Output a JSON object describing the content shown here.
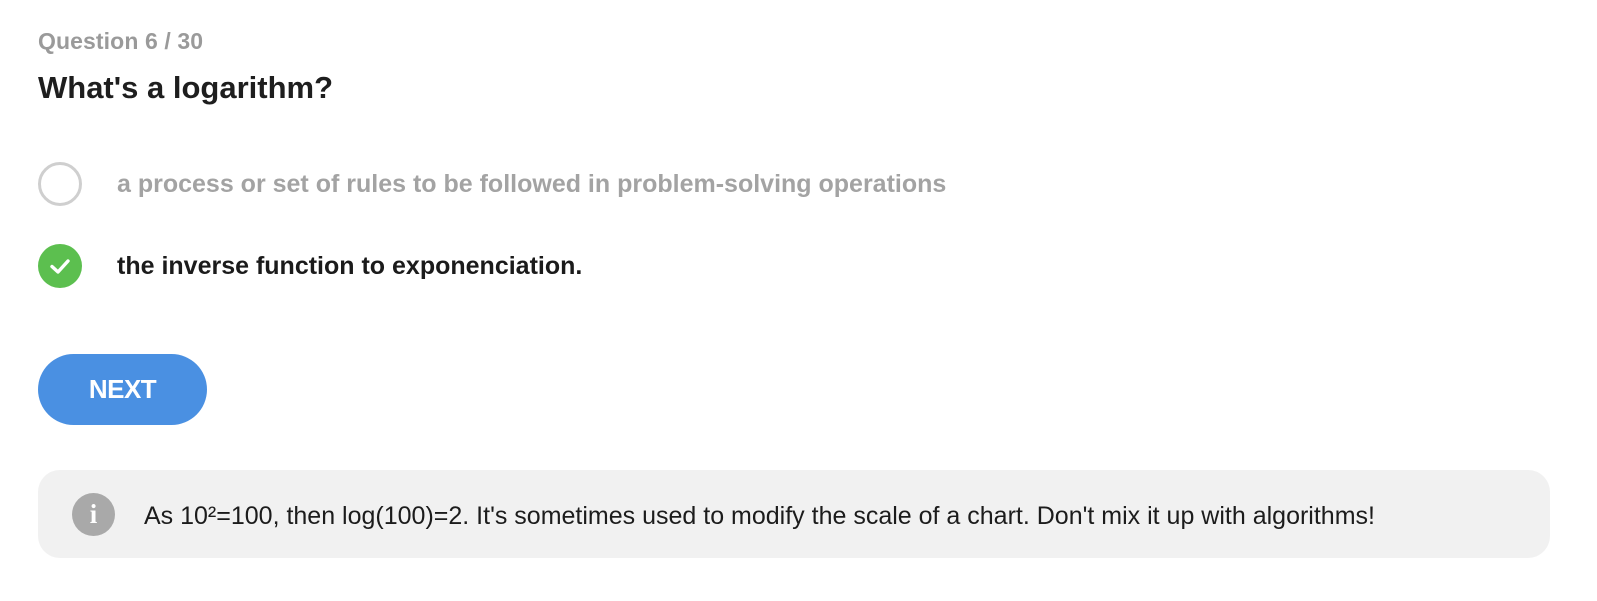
{
  "quiz": {
    "counter": "Question 6 / 30",
    "question": "What's a logarithm?",
    "options": [
      {
        "text": "a process or set of rules to be followed in problem-solving operations",
        "selected": false,
        "icon": "radio-empty-icon"
      },
      {
        "text": "the inverse function to exponenciation.",
        "selected": true,
        "icon": "check-circle-icon"
      }
    ],
    "next_label": "NEXT",
    "info": {
      "icon_glyph": "i",
      "icon": "info-icon",
      "text": "As 10²=100, then log(100)=2. It's sometimes used to modify the scale of a chart. Don't mix it up with algorithms!"
    },
    "colors": {
      "accent": "#4a90e2",
      "correct": "#5cbf4f",
      "muted": "#a3a3a3",
      "info_bg": "#f1f1f1"
    }
  }
}
